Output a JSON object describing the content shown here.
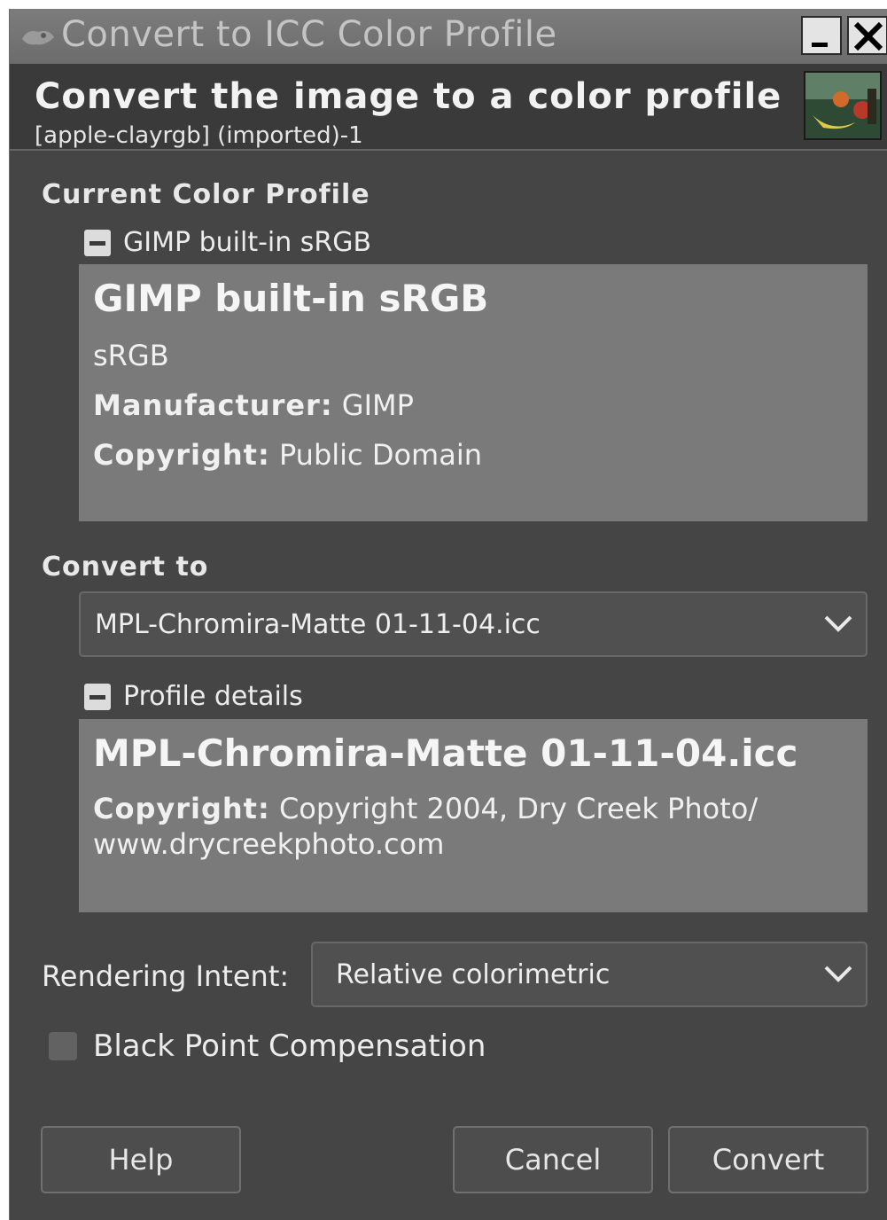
{
  "window": {
    "title": "Convert to ICC Color Profile",
    "minimize_icon": "minimize-icon",
    "close_icon": "close-icon"
  },
  "header": {
    "title": "Convert the image to a color profile",
    "subtitle": "[apple-clayrgb] (imported)-1"
  },
  "current_profile": {
    "section_label": "Current Color Profile",
    "expander_label": "GIMP built-in sRGB",
    "name": "GIMP built-in sRGB",
    "description": "sRGB",
    "manufacturer_label": "Manufacturer:",
    "manufacturer_value": "GIMP",
    "copyright_label": "Copyright:",
    "copyright_value": "Public Domain"
  },
  "convert_to": {
    "section_label": "Convert to",
    "selected_profile": "MPL-Chromira-Matte 01-11-04.icc",
    "details_expander_label": "Profile details",
    "details_name": "MPL-Chromira-Matte 01-11-04.icc",
    "copyright_label": "Copyright:",
    "copyright_value_line1": "Copyright 2004, Dry Creek Photo/",
    "copyright_value_line2": "www.drycreekphoto.com"
  },
  "rendering_intent": {
    "label": "Rendering Intent:",
    "selected": "Relative colorimetric"
  },
  "black_point": {
    "label": "Black Point Compensation",
    "checked": false
  },
  "buttons": {
    "help": "Help",
    "cancel": "Cancel",
    "convert": "Convert"
  }
}
